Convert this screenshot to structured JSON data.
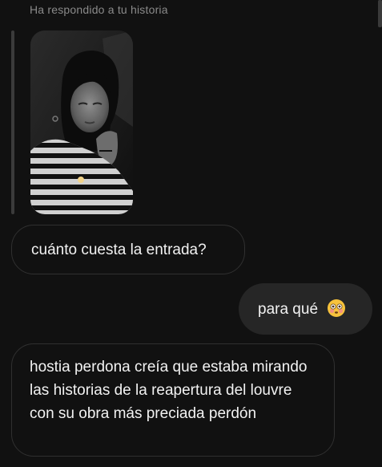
{
  "reply_caption": "Ha respondido a tu historia",
  "story": {
    "thumbnail_icon": "photo-story-thumbnail-icon"
  },
  "messages": [
    {
      "direction": "incoming",
      "text": "cuánto cuesta la entrada?"
    },
    {
      "direction": "outgoing",
      "text": "para qué",
      "emoji": "flushed-face-emoji"
    },
    {
      "direction": "incoming",
      "text": "hostia perdona creía que estaba mirando las historias de la reapertura del louvre con su obra más preciada perdón"
    }
  ],
  "colors": {
    "background": "#111111",
    "incoming_border": "#303030",
    "outgoing_fill": "#262626",
    "caption_text": "#8a8a8a",
    "message_text": "#f2f2f2"
  }
}
